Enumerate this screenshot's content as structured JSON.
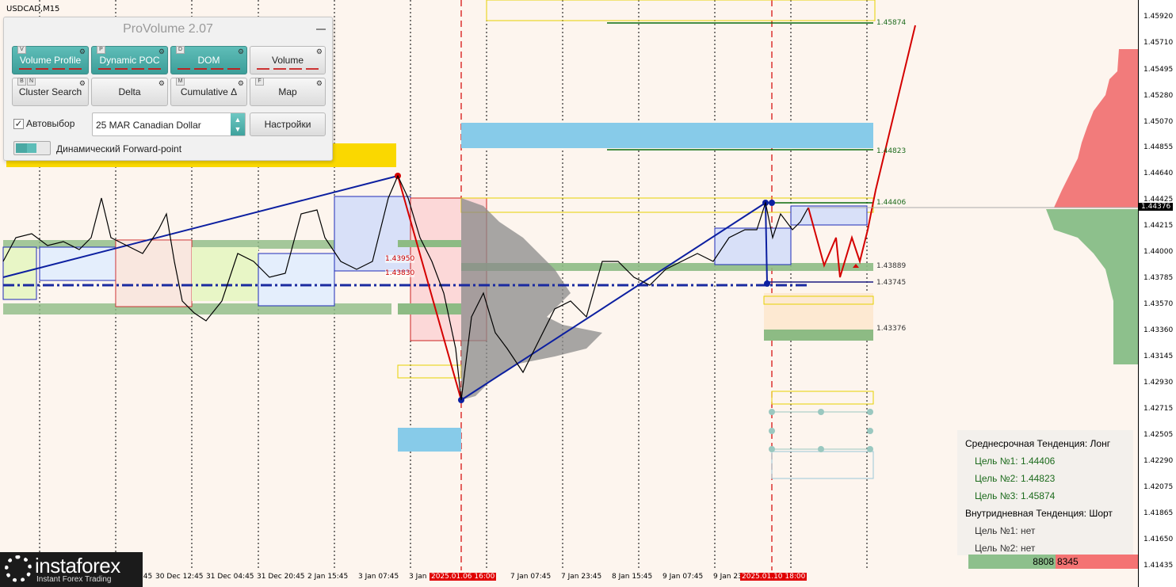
{
  "chart": {
    "symbol": "USDCAD,M15"
  },
  "panel": {
    "title": "ProVolume 2.07",
    "buttons": [
      {
        "label": "Volume Profile",
        "key": "V",
        "active": true
      },
      {
        "label": "Dynamic POC",
        "key": "P",
        "active": true
      },
      {
        "label": "DOM",
        "key": "D",
        "active": true
      },
      {
        "label": "Volume",
        "key": "",
        "active": false
      },
      {
        "label": "Cluster Search",
        "key": "B",
        "key2": "N",
        "active": false
      },
      {
        "label": "Delta",
        "key": "",
        "active": false
      },
      {
        "label": "Cumulative Δ",
        "key": "M",
        "active": false
      },
      {
        "label": "Map",
        "key": "F",
        "active": false
      }
    ],
    "autoselect_label": "Автовыбор",
    "autoselect_checked": true,
    "instrument_value": "25 MAR Canadian Dollar",
    "settings_label": "Настройки",
    "forward_point_label": "Динамический Forward-point"
  },
  "price_axis": {
    "labels": [
      "1.45920",
      "1.45710",
      "1.45495",
      "1.45280",
      "1.45070",
      "1.44855",
      "1.44640",
      "1.44425",
      "1.44215",
      "1.44000",
      "1.43785",
      "1.43570",
      "1.43360",
      "1.43145",
      "1.42930",
      "1.42715",
      "1.42505",
      "1.42290",
      "1.42075",
      "1.41865",
      "1.41650",
      "1.41435"
    ],
    "current_price": "1.44376"
  },
  "time_axis": {
    "labels": [
      "Dec 20:45",
      "30 Dec 12:45",
      "31 Dec 04:45",
      "31 Dec 20:45",
      "2 Jan 15:45",
      "3 Jan 07:45",
      "3 Jan",
      "2025.01.06 16:00",
      "7 Jan 07:45",
      "7 Jan 23:45",
      "8 Jan 15:45",
      "9 Jan 07:45",
      "9 Jan 23",
      "2025.01.10 18:00"
    ]
  },
  "levels": {
    "target3": "1.45874",
    "target2": "1.44823",
    "target1": "1.44406",
    "l1": "1.43889",
    "l2": "1.43745",
    "l3": "1.43376",
    "box_a": "1.43950",
    "box_b": "1.43830"
  },
  "trend_box": {
    "mid_title": "Среднесрочная Тенденция: Лонг",
    "mid_t1": "Цель №1: 1.44406",
    "mid_t2": "Цель №2: 1.44823",
    "mid_t3": "Цель №3: 1.45874",
    "intra_title": "Внутридневная Тенденция: Шорт",
    "intra_t1": "Цель №1: нет",
    "intra_t2": "Цель №2: нет"
  },
  "volume_bar": {
    "buy": "8808",
    "sell": "8345"
  },
  "logo": {
    "name": "instaforex",
    "tagline": "Instant Forex Trading"
  },
  "colors": {
    "background": "#fdf5ee",
    "accent": "#4aa9a4",
    "bull": "#8dc08c",
    "bear": "#f47373",
    "trend_blue": "#0c1fa0",
    "forecast_red": "#d40000"
  }
}
